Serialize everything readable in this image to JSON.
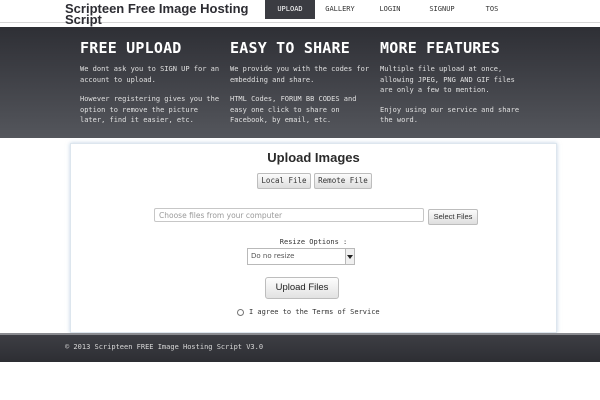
{
  "header": {
    "site_title": "Scripteen Free Image Hosting Script",
    "nav": [
      {
        "label": "UPLOAD",
        "active": true
      },
      {
        "label": "GALLERY",
        "active": false
      },
      {
        "label": "LOGIN",
        "active": false
      },
      {
        "label": "SIGNUP",
        "active": false
      },
      {
        "label": "TOS",
        "active": false
      }
    ]
  },
  "hero": {
    "features": [
      {
        "title": "FREE UPLOAD",
        "paragraphs": [
          "We dont ask you to SIGN UP for an account to upload.",
          "However registering gives you the option to remove the picture later, find it easier, etc."
        ]
      },
      {
        "title": "EASY TO SHARE",
        "paragraphs": [
          "We provide you with the codes for embedding and share.",
          "HTML Codes, FORUM BB CODES and easy one click to share on Facebook, by email, etc."
        ]
      },
      {
        "title": "MORE FEATURES",
        "paragraphs": [
          "Multiple file upload at once, allowing JPEG, PNG AND GIF files are only a few to mention.",
          "Enjoy using our service and share the word."
        ]
      }
    ]
  },
  "upload": {
    "title": "Upload Images",
    "tab_local": "Local File",
    "tab_remote": "Remote File",
    "file_placeholder": "Choose files from your computer",
    "select_files": "Select Files",
    "resize_label": "Resize Options :",
    "resize_selected": "Do no resize",
    "upload_button": "Upload Files",
    "agree_text": "I agree to the Terms of Service"
  },
  "footer": {
    "copyright": "© 2013 Scripteen FREE Image Hosting Script V3.0"
  },
  "colors": {
    "header_dark": "#3b3c42",
    "hero_top": "#2e2f35",
    "hero_bottom": "#54565c",
    "footer": "#2d2e33"
  }
}
